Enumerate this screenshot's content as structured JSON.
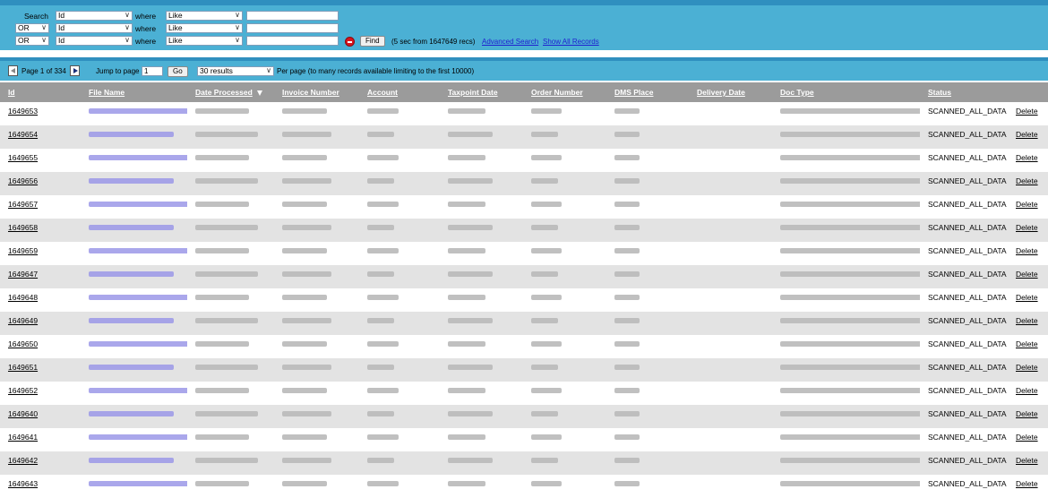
{
  "search": {
    "label": "Search",
    "rows": [
      {
        "connector": "",
        "field": "Id",
        "where": "where",
        "op": "Like",
        "value": ""
      },
      {
        "connector": "OR",
        "field": "Id",
        "where": "where",
        "op": "Like",
        "value": ""
      },
      {
        "connector": "OR",
        "field": "Id",
        "where": "where",
        "op": "Like",
        "value": ""
      }
    ],
    "find_label": "Find",
    "info": "(5 sec from 1647649 recs)",
    "advanced_link": "Advanced Search",
    "show_all_link": "Show All Records"
  },
  "pager": {
    "page_text": "Page 1 of 334",
    "jump_label": "Jump to page",
    "jump_value": "1",
    "go_label": "Go",
    "per_page_value": "30 results",
    "per_page_note": "Per page (to many records available limiting to the first 10000)"
  },
  "table": {
    "columns": [
      "Id",
      "File Name",
      "Date Processed",
      "Invoice Number",
      "Account",
      "Taxpoint Date",
      "Order Number",
      "DMS Place",
      "Delivery Date",
      "Doc Type",
      "Status",
      ""
    ],
    "sorted_column": "Date Processed",
    "rows": [
      {
        "id": "1649653",
        "status": "SCANNED_ALL_DATA",
        "action": "Delete"
      },
      {
        "id": "1649654",
        "status": "SCANNED_ALL_DATA",
        "action": "Delete"
      },
      {
        "id": "1649655",
        "status": "SCANNED_ALL_DATA",
        "action": "Delete"
      },
      {
        "id": "1649656",
        "status": "SCANNED_ALL_DATA",
        "action": "Delete"
      },
      {
        "id": "1649657",
        "status": "SCANNED_ALL_DATA",
        "action": "Delete"
      },
      {
        "id": "1649658",
        "status": "SCANNED_ALL_DATA",
        "action": "Delete"
      },
      {
        "id": "1649659",
        "status": "SCANNED_ALL_DATA",
        "action": "Delete"
      },
      {
        "id": "1649647",
        "status": "SCANNED_ALL_DATA",
        "action": "Delete"
      },
      {
        "id": "1649648",
        "status": "SCANNED_ALL_DATA",
        "action": "Delete"
      },
      {
        "id": "1649649",
        "status": "SCANNED_ALL_DATA",
        "action": "Delete"
      },
      {
        "id": "1649650",
        "status": "SCANNED_ALL_DATA",
        "action": "Delete"
      },
      {
        "id": "1649651",
        "status": "SCANNED_ALL_DATA",
        "action": "Delete"
      },
      {
        "id": "1649652",
        "status": "SCANNED_ALL_DATA",
        "action": "Delete"
      },
      {
        "id": "1649640",
        "status": "SCANNED_ALL_DATA",
        "action": "Delete"
      },
      {
        "id": "1649641",
        "status": "SCANNED_ALL_DATA",
        "action": "Delete"
      },
      {
        "id": "1649642",
        "status": "SCANNED_ALL_DATA",
        "action": "Delete"
      },
      {
        "id": "1649643",
        "status": "SCANNED_ALL_DATA",
        "action": "Delete"
      }
    ]
  },
  "colors": {
    "panel": "#4bb0d4",
    "bar": "#2f8fbf",
    "header": "#9b9b9b",
    "row_alt": "#e3e3e3",
    "link": "#2020d0",
    "remove": "#d8141c"
  },
  "icons": {
    "remove": "minus-circle-icon",
    "prev": "prev-page-icon",
    "next": "next-page-icon",
    "sort": "sort-desc-icon",
    "dropdown": "chevron-down-icon"
  }
}
